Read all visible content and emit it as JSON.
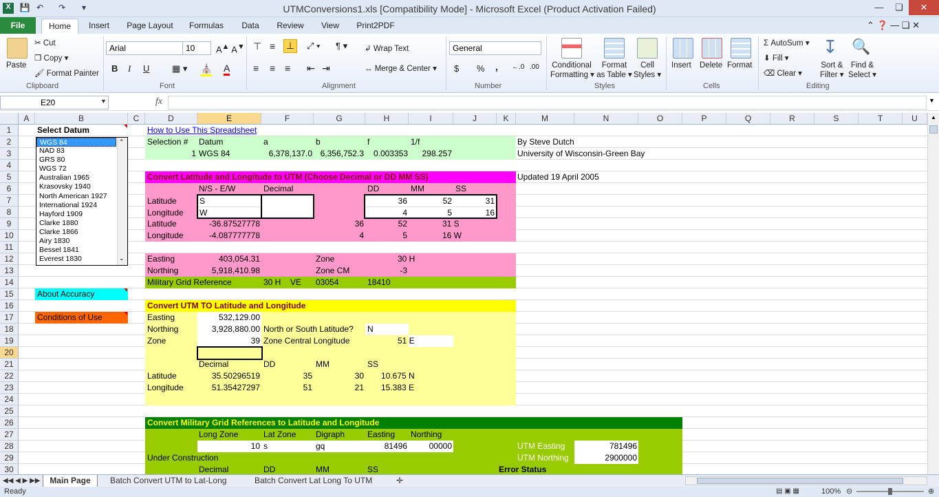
{
  "window": {
    "title": "UTMConversions1.xls  [Compatibility Mode]  -  Microsoft Excel (Product Activation Failed)"
  },
  "ribbon_tabs": [
    "File",
    "Home",
    "Insert",
    "Page Layout",
    "Formulas",
    "Data",
    "Review",
    "View",
    "Print2PDF"
  ],
  "clipboard": {
    "paste": "Paste",
    "cut": "Cut",
    "copy": "Copy",
    "format_painter": "Format Painter",
    "label": "Clipboard"
  },
  "font": {
    "name": "Arial",
    "size": "10",
    "label": "Font",
    "bold": "B",
    "italic": "I",
    "underline": "U"
  },
  "alignment": {
    "wrap": "Wrap Text",
    "merge": "Merge & Center",
    "label": "Alignment"
  },
  "number": {
    "format": "General",
    "label": "Number",
    "currency": "$",
    "percent": "%",
    "comma": ","
  },
  "styles": {
    "conditional": "Conditional",
    "conditional2": "Formatting",
    "format_as": "Format",
    "format_as2": "as Table",
    "cell": "Cell",
    "cell2": "Styles",
    "label": "Styles"
  },
  "cells": {
    "insert": "Insert",
    "delete": "Delete",
    "format": "Format",
    "label": "Cells"
  },
  "editing": {
    "autosum": "AutoSum",
    "fill": "Fill",
    "clear": "Clear",
    "sort": "Sort &",
    "sort2": "Filter",
    "find": "Find &",
    "find2": "Select",
    "label": "Editing"
  },
  "formula_bar": {
    "name_box": "E20",
    "fx": "fx",
    "value": ""
  },
  "columns": [
    "A",
    "B",
    "C",
    "D",
    "E",
    "F",
    "G",
    "H",
    "I",
    "J",
    "K",
    "M",
    "N",
    "O",
    "P",
    "Q",
    "R",
    "S",
    "T",
    "U"
  ],
  "rows": [
    "1",
    "2",
    "3",
    "4",
    "5",
    "6",
    "7",
    "8",
    "9",
    "10",
    "11",
    "12",
    "13",
    "14",
    "15",
    "16",
    "17",
    "18",
    "19",
    "20",
    "21",
    "22",
    "23",
    "24",
    "25",
    "26",
    "27",
    "28",
    "29",
    "30"
  ],
  "datum_list": [
    "WGS 84",
    "NAD 83",
    "GRS 80",
    "WGS 72",
    "Australian 1965",
    "Krasovsky 1940",
    "North American 1927",
    "International 1924",
    "Hayford 1909",
    "Clarke 1880",
    "Clarke 1866",
    "Airy 1830",
    "Bessel 1841",
    "Everest 1830"
  ],
  "cells_text": {
    "select_datum": "Select Datum",
    "how_to": "How to Use This Spreadsheet",
    "sel_hdr": "Selection #",
    "datum_hdr": "Datum",
    "a_hdr": "a",
    "b_hdr": "b",
    "f_hdr": "f",
    "inv_f_hdr": "1/f",
    "sel_num": "1",
    "sel_datum": "WGS 84",
    "a_val": "6,378,137.0",
    "b_val": "6,356,752.3",
    "f_val": "0.003353",
    "inv_f_val": "298.257",
    "by": "By Steve Dutch",
    "univ": "University of Wisconsin-Green Bay",
    "updated": "Updated 19 April 2005",
    "conv1_title": "Convert Latitude and Longitude to UTM (Choose Decimal or DD MM SS)",
    "ns_ew": "N/S - E/W",
    "decimal": "Decimal",
    "dd": "DD",
    "mm": "MM",
    "ss": "SS",
    "latitude": "Latitude",
    "longitude": "Longitude",
    "lat_dir": "S",
    "lon_dir": "W",
    "lat_dd_in": "36",
    "lat_mm_in": "52",
    "lat_ss_in": "31",
    "lon_dd_in": "4",
    "lon_mm_in": "5",
    "lon_ss_in": "16",
    "lat_dec": "-36.87527778",
    "lat_dd": "36",
    "lat_mm": "52",
    "lat_ss": "31 S",
    "lon_dec": "-4.087777778",
    "lon_dd": "4",
    "lon_mm": "5",
    "lon_ss": "16 W",
    "easting": "Easting",
    "easting_val": "403,054.31",
    "zone": "Zone",
    "zone_val": "30 H",
    "northing": "Northing",
    "northing_val": "5,918,410.98",
    "zone_cm": "Zone CM",
    "zone_cm_val": "-3",
    "mgr": "Military Grid Reference",
    "mgr_zone": "30 H",
    "mgr_sq": "VE",
    "mgr_e": "03054",
    "mgr_n": "18410",
    "about_acc": "About Accuracy",
    "conditions": "Conditions of Use",
    "conv2_title": "Convert UTM TO Latitude and Longitude",
    "utm_e": "532,129.00",
    "utm_n": "3,928,880.00",
    "ns_q": "North or South Latitude?",
    "ns_a": "N",
    "utm_zone": "39",
    "zcl": "Zone Central Longitude",
    "zcl_val": "51 E",
    "r22_dec": "35.50296519",
    "r22_dd": "35",
    "r22_mm": "30",
    "r22_ss": "10.675 N",
    "r23_dec": "51.35427297",
    "r23_dd": "51",
    "r23_mm": "21",
    "r23_ss": "15.383 E",
    "conv3_title": "Convert Military Grid References to Latitude and Longitude",
    "long_zone": "Long Zone",
    "lat_zone": "Lat Zone",
    "digraph": "Digraph",
    "easting2": "Easting",
    "northing2": "Northing",
    "lz_val": "10",
    "latz_val": "s",
    "dig_val": "gq",
    "e2_val": "81496",
    "n2_val": "00000",
    "utm_easting_lbl": "UTM Easting",
    "utm_easting_val": "781496",
    "utm_northing_lbl": "UTM Northing",
    "utm_northing_val": "2900000",
    "under": "Under Construction",
    "error_status": "Error Status"
  },
  "sheet_tabs": [
    "Main Page",
    "Batch Convert UTM to Lat-Long",
    "Batch Convert Lat Long To UTM"
  ],
  "status": {
    "ready": "Ready",
    "zoom": "100%"
  },
  "colors": {
    "excel_green": "#2a8a3e",
    "magenta": "#ff00ff",
    "pink": "#ff99cc",
    "light_green": "#ccffcc",
    "olive": "#99cc00",
    "yellow": "#ffff00",
    "light_yellow": "#ffff99",
    "cyan": "#00ffff",
    "orange": "#ff6600",
    "dark_green": "#008000"
  }
}
